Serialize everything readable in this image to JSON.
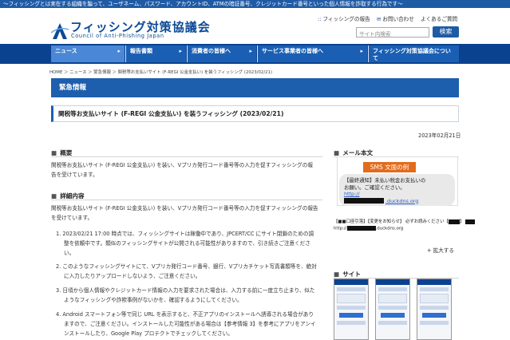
{
  "topbar": {
    "text": "～フィッシングとは実在する組織を騙って、ユーザネーム、パスワード、アカウントID、ATMの暗証番号、クレジットカード番号といった個人情報を詐取する行為です～"
  },
  "header": {
    "logo_jp": "フィッシング対策協議会",
    "logo_en": "Council of Anti-Phishing Japan",
    "links": [
      "フィッシングの報告",
      "お問い合わせ",
      "よくあるご質問"
    ],
    "search_placeholder": "サイト内検索",
    "search_button": "検索"
  },
  "nav": {
    "items": [
      "ニュース",
      "報告書類",
      "消費者の皆様へ",
      "サービス事業者の皆様へ",
      "フィッシング対策協議会について"
    ]
  },
  "breadcrumb": "HOME ＞ ニュース ＞ 緊急情報 ＞ 関税等お支払いサイト (F-REGI 公金支払い) を装うフィッシング (2023/02/21)",
  "section_banner": "緊急情報",
  "article": {
    "title": "関税等お支払いサイト (F-REGI 公金支払い) を装うフィッシング (2023/02/21)",
    "date": "2023年02月21日",
    "overview_heading": "概要",
    "overview_text_1": "関税等お支払いサイト (F-REGI 公金支払い) を装い、Vプリカ発行コード番号等の入力を促すフィッシングの報",
    "overview_text_2": "告を受けています。",
    "details_heading": "詳細内容",
    "details_text_1": "関税等お支払いサイト (F-REGI 公金支払い) を装い、Vプリカ発行コード番号等の入力を促すフィッシングの報告",
    "details_text_2": "を受けています。",
    "items": [
      [
        "1. 2023/02/21 17:00 時点では、フィッシングサイトは稼働中であり、JPCERT/CC にサイト閉鎖のための調",
        "整を依頼中です。類似のフィッシングサイトが公開される可能性がありますので、引き続きご注意くださ",
        "い。"
      ],
      [
        "2. このようなフィッシングサイトにて、Vプリカ発行コード番号、銀行、Vプリカチケット写真書類等を、絶対",
        "に入力したりアップロードしないよう、ご注意ください。"
      ],
      [
        "3. 日頃から個人情報やクレジットカード情報の入力を要求された場合は、入力する前に一度立ち止まり、似た",
        "ようなフィッシングや詐欺事例がないかを、確認するようにしてください。"
      ],
      [
        "4. Android スマートフォン等で同じ URL を表示すると、不正アプリのインストールへ誘導される場合があり",
        "ますので、ご注意ください。インストールした可能性がある場合は【参考情報 3】を参考にアプリをアンイ",
        "ンストールしたり、Google Play プロテクトでチェックしてください。"
      ]
    ]
  },
  "sidebar": {
    "mail_heading": "メール本文",
    "sms_label": "SMS 文面の例",
    "bubble_lines": [
      "【最終通知】未払い税金お支払いの",
      "お願い。ご確認ください。"
    ],
    "bubble_link": "http://",
    "bubble_domain": ".duckdns.org",
    "note_1": "【■■口座引落】【変更をお知らせ】 必ずお読みください【",
    "note_2": "http://",
    "note_2_domain": ".duckdns.org",
    "expand_label": "+ 拡大する",
    "site_heading": "サイト"
  },
  "colors": {
    "primary": "#1d5ead",
    "nav_bg": "#0b4290",
    "accent_orange": "#e36b1b"
  }
}
